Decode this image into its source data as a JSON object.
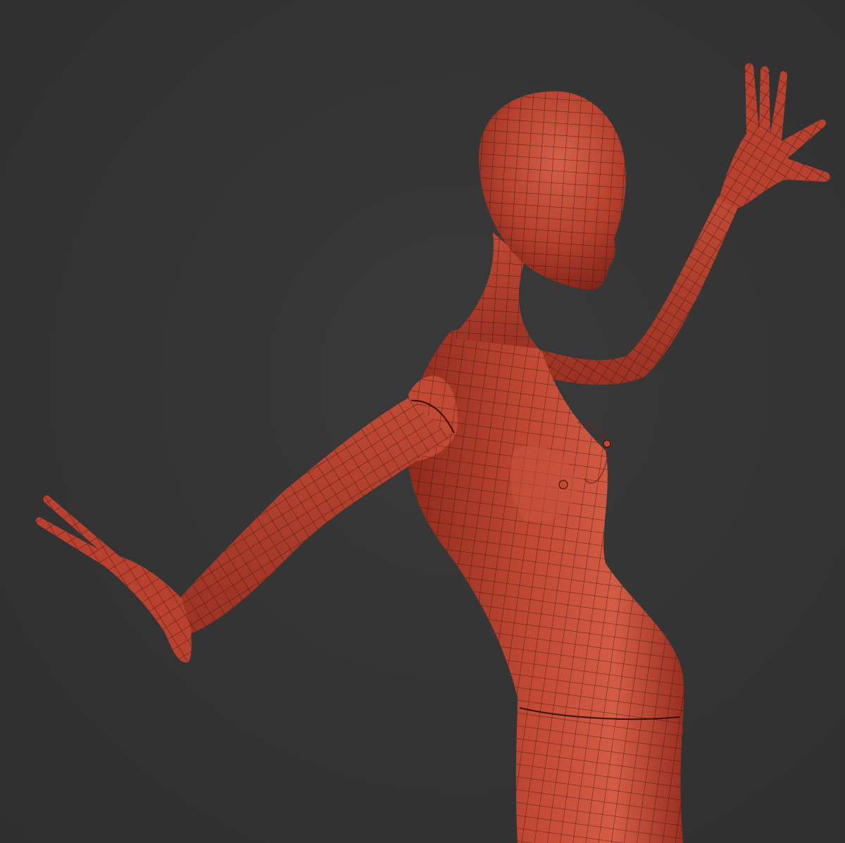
{
  "viewport": {
    "background_color": "#353535"
  },
  "model": {
    "surface_color": "#b8412f",
    "highlight_color": "#d9604a",
    "shadow_color": "#6e1d14",
    "wire_color": "#2a0c08",
    "view_mode": "wireframe-over-shaded"
  }
}
